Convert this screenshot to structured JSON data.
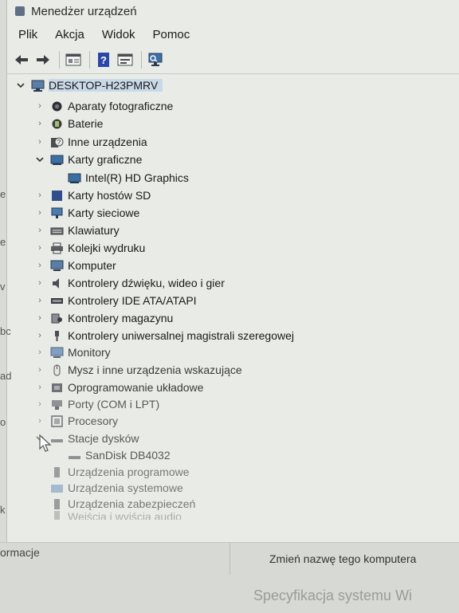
{
  "window": {
    "title": "Menedżer urządzeń"
  },
  "menu": [
    "Plik",
    "Akcja",
    "Widok",
    "Pomoc"
  ],
  "toolbar": {
    "buttons": [
      "back-arrow-icon",
      "forward-arrow-icon",
      "properties-icon",
      "help-icon",
      "update-driver-icon",
      "scan-hardware-icon"
    ]
  },
  "tree": {
    "root": "DESKTOP-H23PMRV",
    "nodes": [
      {
        "label": "Aparaty fotograficzne",
        "icon": "camera-icon",
        "expanded": false
      },
      {
        "label": "Baterie",
        "icon": "battery-icon",
        "expanded": false
      },
      {
        "label": "Inne urządzenia",
        "icon": "unknown-device-icon",
        "expanded": false
      },
      {
        "label": "Karty graficzne",
        "icon": "display-adapter-icon",
        "expanded": true
      },
      {
        "label": "Intel(R) HD Graphics",
        "icon": "display-adapter-icon",
        "child": true
      },
      {
        "label": "Karty hostów SD",
        "icon": "sd-host-icon",
        "expanded": false
      },
      {
        "label": "Karty sieciowe",
        "icon": "network-adapter-icon",
        "expanded": false
      },
      {
        "label": "Klawiatury",
        "icon": "keyboard-icon",
        "expanded": false
      },
      {
        "label": "Kolejki wydruku",
        "icon": "printer-icon",
        "expanded": false
      },
      {
        "label": "Komputer",
        "icon": "computer-icon",
        "expanded": false
      },
      {
        "label": "Kontrolery dźwięku, wideo i gier",
        "icon": "speaker-icon",
        "expanded": false
      },
      {
        "label": "Kontrolery IDE ATA/ATAPI",
        "icon": "ide-controller-icon",
        "expanded": false
      },
      {
        "label": "Kontrolery magazynu",
        "icon": "storage-controller-icon",
        "expanded": false
      },
      {
        "label": "Kontrolery uniwersalnej magistrali szeregowej",
        "icon": "usb-icon",
        "expanded": false
      },
      {
        "label": "Monitory",
        "icon": "monitor-icon",
        "expanded": false
      },
      {
        "label": "Mysz i inne urządzenia wskazujące",
        "icon": "mouse-icon",
        "expanded": false
      },
      {
        "label": "Oprogramowanie układowe",
        "icon": "firmware-icon",
        "expanded": false
      },
      {
        "label": "Porty (COM i LPT)",
        "icon": "port-icon",
        "expanded": false
      },
      {
        "label": "Procesory",
        "icon": "processor-icon",
        "expanded": false
      },
      {
        "label": "Stacje dysków",
        "icon": "disk-drive-icon",
        "expanded": true
      },
      {
        "label": "SanDisk DB4032",
        "icon": "disk-drive-icon",
        "child": true
      },
      {
        "label": "Urządzenia programowe",
        "icon": "software-device-icon",
        "expanded": false
      },
      {
        "label": "Urządzenia systemowe",
        "icon": "system-device-icon",
        "expanded": false
      },
      {
        "label": "Urządzenia zabezpieczeń",
        "icon": "security-device-icon",
        "expanded": false
      },
      {
        "label": "Wejścia i wyjścia audio",
        "icon": "audio-io-icon",
        "expanded": false
      }
    ]
  },
  "status": {
    "left": "ormacje",
    "right": "Zmień nazwę tego komputera",
    "bottom_partial": "Specyfikacja systemu Wi"
  },
  "left_clips": [
    "e",
    "e",
    "v",
    "bc",
    "ad",
    "o",
    "k"
  ]
}
